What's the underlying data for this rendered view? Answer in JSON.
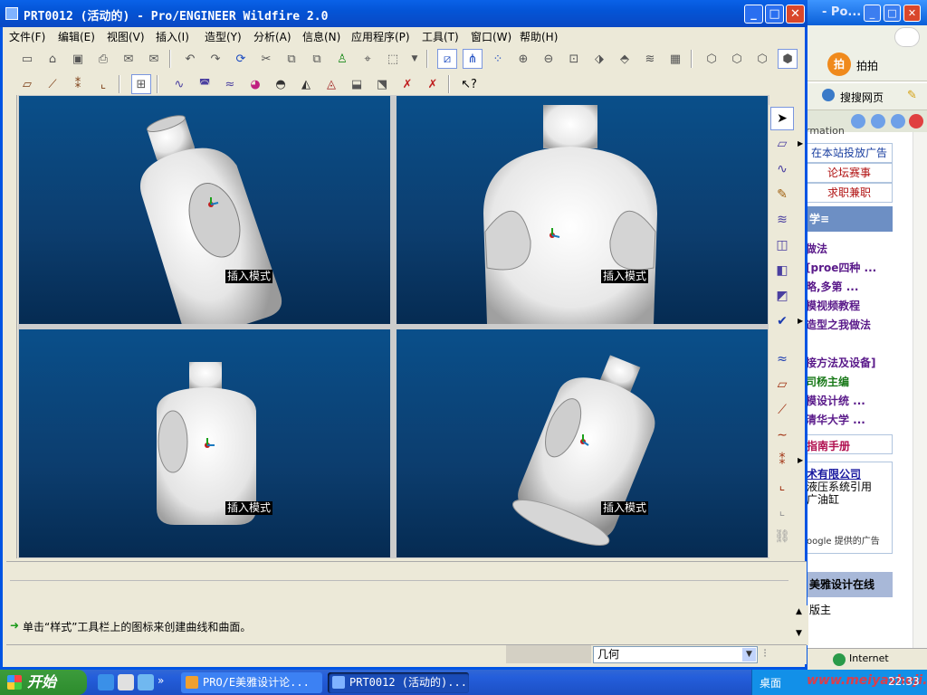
{
  "window": {
    "title": "PRT0012 (活动的) - Pro/ENGINEER Wildfire 2.0",
    "controls": {
      "minimize": "_",
      "maximize": "□",
      "close": "✕"
    }
  },
  "menubar": [
    "文件(F)",
    "编辑(E)",
    "视图(V)",
    "插入(I)",
    "造型(Y)",
    "分析(A)",
    "信息(N)",
    "应用程序(P)",
    "工具(T)",
    "窗口(W)",
    "帮助(H)"
  ],
  "viewports": [
    {
      "label": "插入模式"
    },
    {
      "label": "插入模式"
    },
    {
      "label": "插入模式"
    },
    {
      "label": "插入模式"
    }
  ],
  "message": {
    "text": "单击“样式”工具栏上的图标来创建曲线和曲面。"
  },
  "status": {
    "filter_value": "几何"
  },
  "background_window": {
    "title": "- Po...",
    "toolbar_items": [
      "拍拍",
      "搜搜网页"
    ],
    "partial_header": "rmation",
    "links_boxed": [
      "在本站投放广告",
      "论坛赛事",
      "求职兼职"
    ],
    "section_header": "学≡",
    "list_items": [
      "做法",
      "[proe四种 ...",
      "略,多第 ...",
      "模视频教程",
      "造型之我做法",
      "接方法及设备]",
      "司杨主编",
      "模设计统 ...",
      "清华大学 ...",
      "指南手册"
    ],
    "ad_text": [
      "术有限公司",
      "液压系统引用",
      "广油缸",
      "oogle 提供的广告"
    ],
    "section2_header": "美雅设计在线",
    "section2_item": "版主",
    "status_zone": "Internet"
  },
  "taskbar": {
    "start_label": "开始",
    "tasks": [
      "PRO/E美雅设计论...",
      "PRT0012 (活动的)..."
    ],
    "tray_label": "桌面",
    "clock": "22:33",
    "watermark": "www.meiyasheji.com"
  },
  "colors": {
    "viewport_top": "#0a4f8a",
    "viewport_bottom": "#052b52",
    "titlebar": "#0a5fd8",
    "start_green": "#3c9c3c"
  }
}
